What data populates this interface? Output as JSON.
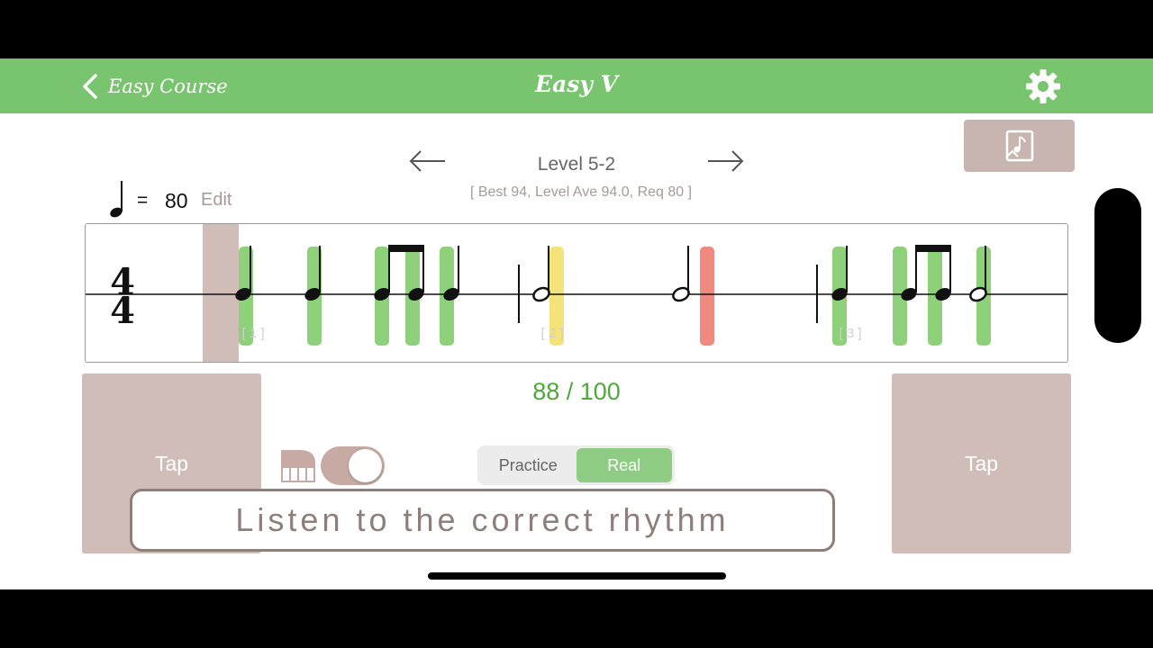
{
  "navbar": {
    "back_label": "Easy Course",
    "title": "Easy V",
    "background_color": "#79c46e",
    "back_icon": "chevron-left-icon",
    "settings_icon": "gear-icon"
  },
  "sheet_button": {
    "icon": "music-sheet-icon"
  },
  "level": {
    "title": "Level 5-2",
    "stats": "[ Best 94, Level Ave 94.0, Req 80 ]"
  },
  "tempo": {
    "equals": "=",
    "bpm": "80",
    "edit_label": "Edit"
  },
  "staff": {
    "time_signature_top": "4",
    "time_signature_bottom": "4",
    "measure_labels": [
      "[ 1 ]",
      "[ 2 ]",
      "[ 3 ]"
    ],
    "colors": {
      "hit": "#8fd07a",
      "early": "#f3e37a",
      "miss": "#f08a80",
      "cursor": "#d1bdb8"
    }
  },
  "score": {
    "text": "88 / 100",
    "color": "#4fa83b"
  },
  "tap_pads": {
    "left_label": "Tap",
    "right_label": "Tap"
  },
  "piano_toggle": {
    "icon": "piano-icon",
    "on": true
  },
  "mode": {
    "practice_label": "Practice",
    "real_label": "Real",
    "selected": "Real"
  },
  "message": "Listen to the correct rhythm"
}
